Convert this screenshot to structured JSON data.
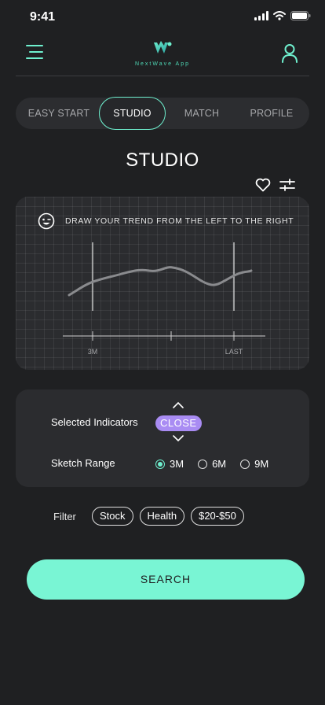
{
  "status_bar": {
    "time": "9:41"
  },
  "header": {
    "app_name": "NextWave App",
    "menu_icon": "hamburger-menu-icon",
    "user_icon": "user-profile-icon",
    "logo_icon": "nextwave-logo-icon"
  },
  "tabs": [
    {
      "label": "EASY START",
      "active": false
    },
    {
      "label": "STUDIO",
      "active": true
    },
    {
      "label": "MATCH",
      "active": false
    },
    {
      "label": "PROFILE",
      "active": false
    }
  ],
  "page_title": "STUDIO",
  "actions": {
    "favorite_icon": "heart-icon",
    "adjust_icon": "sliders-icon"
  },
  "sketch": {
    "instruction": "DRAW YOUR TREND FROM THE LEFT TO THE RIGHT",
    "icon": "smile-icon",
    "axis_start_label": "3M",
    "axis_end_label": "LAST"
  },
  "indicators": {
    "selected_label": "Selected Indicators",
    "selected_value": "CLOSE",
    "range_label": "Sketch Range",
    "range_options": [
      "3M",
      "6M",
      "9M"
    ],
    "range_selected": "3M"
  },
  "filter": {
    "label": "Filter",
    "chips": [
      "Stock",
      "Health",
      "$20-$50"
    ]
  },
  "search_label": "SEARCH",
  "colors": {
    "accent": "#6ff0cf",
    "badge": "#a98cf3",
    "background": "#1f2022",
    "card": "#2b2c2f"
  }
}
